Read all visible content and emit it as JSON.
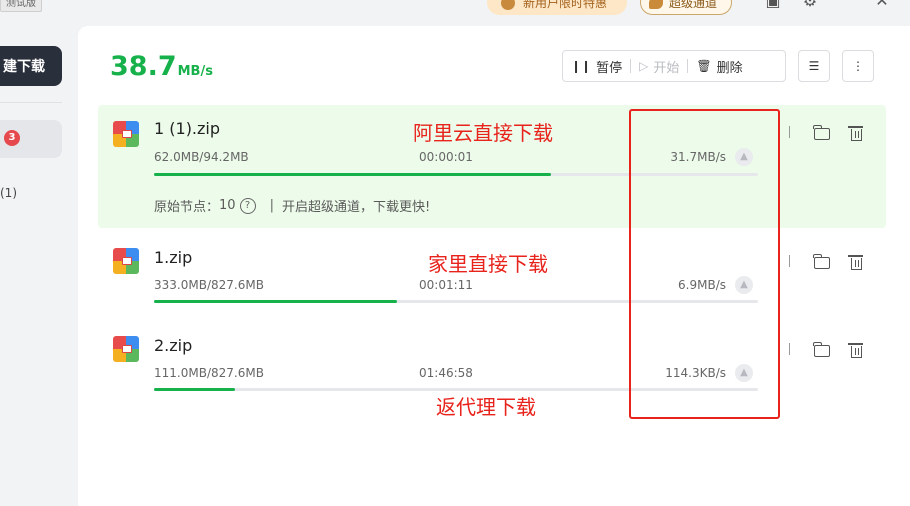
{
  "app": {
    "beta_label": "测试版",
    "promo_label": "新用户限时特惠",
    "super_channel_label": "超级通道",
    "new_task_label": "建下载",
    "downloading_badge": "3",
    "completed_count": "(1)"
  },
  "summary": {
    "total_speed_value": "38.7",
    "total_speed_unit": "MB/s"
  },
  "toolbar": {
    "pause_label": "暂停",
    "start_label": "开始",
    "delete_label": "删除"
  },
  "downloads": [
    {
      "name": "1 (1).zip",
      "size": "62.0MB/94.2MB",
      "elapsed": "00:00:01",
      "speed": "31.7MB/s",
      "progress": 0.658,
      "node_label": "原始节点：",
      "node_count": "10",
      "super_hint": "开启超级通道，下载更快!"
    },
    {
      "name": "1.zip",
      "size": "333.0MB/827.6MB",
      "elapsed": "00:01:11",
      "speed": "6.9MB/s",
      "progress": 0.402
    },
    {
      "name": "2.zip",
      "size": "111.0MB/827.6MB",
      "elapsed": "01:46:58",
      "speed": "114.3KB/s",
      "progress": 0.134
    }
  ],
  "annotations": {
    "aliyun": "阿里云直接下载",
    "home": "家里直接下载",
    "proxy": "返代理下载"
  },
  "colors": {
    "accent_green": "#17b14b",
    "annotation_red": "#e8231c",
    "active_row_bg": "#edfcea"
  }
}
